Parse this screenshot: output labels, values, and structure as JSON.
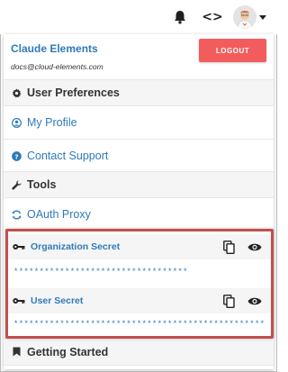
{
  "header": {
    "bell_icon": "bell-icon",
    "code_icon": "code-icon",
    "code_glyph": "<>",
    "avatar_icon": "avatar-icon",
    "caret_icon": "caret-down-icon"
  },
  "user": {
    "name": "Claude Elements",
    "email": "docs@cloud-elements.com",
    "logout_label": "LOGOUT"
  },
  "sections": {
    "preferences": {
      "label": "User Preferences",
      "icon": "gear-icon"
    },
    "tools": {
      "label": "Tools",
      "icon": "wrench-icon"
    },
    "getting_started": {
      "label": "Getting Started",
      "icon": "bookmark-icon"
    }
  },
  "items": {
    "my_profile": {
      "label": "My Profile",
      "icon": "profile-icon"
    },
    "contact_support": {
      "label": "Contact Support",
      "icon": "question-icon"
    },
    "oauth_proxy": {
      "label": "OAuth Proxy",
      "icon": "refresh-icon"
    }
  },
  "secrets": [
    {
      "label": "Organization Secret",
      "value": "**********************************"
    },
    {
      "label": "User Secret",
      "value": "*************************************************"
    }
  ],
  "colors": {
    "accent": "#2f7ab9",
    "logout": "#f25c5c",
    "highlight": "#c0504d"
  }
}
